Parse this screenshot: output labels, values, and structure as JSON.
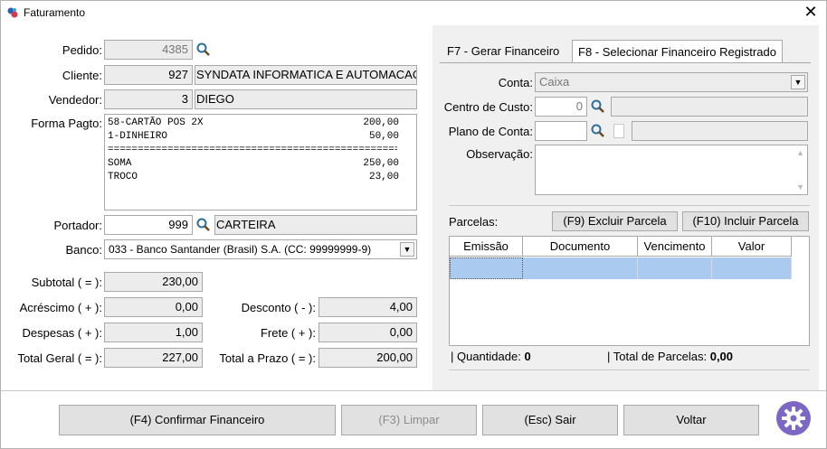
{
  "window": {
    "title": "Faturamento"
  },
  "left": {
    "pedido_label": "Pedido:",
    "pedido_value": "4385",
    "cliente_label": "Cliente:",
    "cliente_code": "927",
    "cliente_name": "SYNDATA INFORMATICA E AUTOMACAO",
    "vendedor_label": "Vendedor:",
    "vendedor_code": "3",
    "vendedor_name": "DIEGO",
    "forma_pagto_label": "Forma Pagto:",
    "forma_pagto_lines": [
      {
        "desc": "58-CARTÃO POS 2X",
        "val": "200,00"
      },
      {
        "desc": "1-DINHEIRO",
        "val": "50,00"
      },
      {
        "desc": "==================================================",
        "val": ""
      },
      {
        "desc": "SOMA",
        "val": "250,00"
      },
      {
        "desc": "TROCO",
        "val": "23,00"
      }
    ],
    "portador_label": "Portador:",
    "portador_code": "999",
    "portador_name": "CARTEIRA",
    "banco_label": "Banco:",
    "banco_value": "033 - Banco Santander (Brasil) S.A. (CC: 99999999-9)",
    "subtotal_label": "Subtotal ( = ):",
    "subtotal_value": "230,00",
    "acrescimo_label": "Acréscimo ( + ):",
    "acrescimo_value": "0,00",
    "despesas_label": "Despesas ( + ):",
    "despesas_value": "1,00",
    "total_geral_label": "Total Geral ( = ):",
    "total_geral_value": "227,00",
    "desconto_label": "Desconto ( - ):",
    "desconto_value": "4,00",
    "frete_label": "Frete ( + ):",
    "frete_value": "0,00",
    "total_prazo_label": "Total a Prazo ( = ):",
    "total_prazo_value": "200,00"
  },
  "right": {
    "tab1": "F7 - Gerar Financeiro",
    "tab2": "F8 - Selecionar Financeiro Registrado",
    "conta_label": "Conta:",
    "conta_value": "Caixa",
    "centro_label": "Centro de Custo:",
    "centro_value": "0",
    "plano_label": "Plano de Conta:",
    "obs_label": "Observação:",
    "parcelas_label": "Parcelas:",
    "excluir_btn": "(F9) Excluir Parcela",
    "incluir_btn": "(F10) Incluir Parcela",
    "columns": [
      "Emissão",
      "Documento",
      "Vencimento",
      "Valor"
    ],
    "quantidade_label": "| Quantidade:",
    "quantidade_value": "0",
    "total_parcelas_label": "| Total de Parcelas:",
    "total_parcelas_value": "0,00"
  },
  "footer": {
    "confirmar": "(F4) Confirmar Financeiro",
    "limpar": "(F3) Limpar",
    "sair": "(Esc) Sair",
    "voltar": "Voltar"
  }
}
